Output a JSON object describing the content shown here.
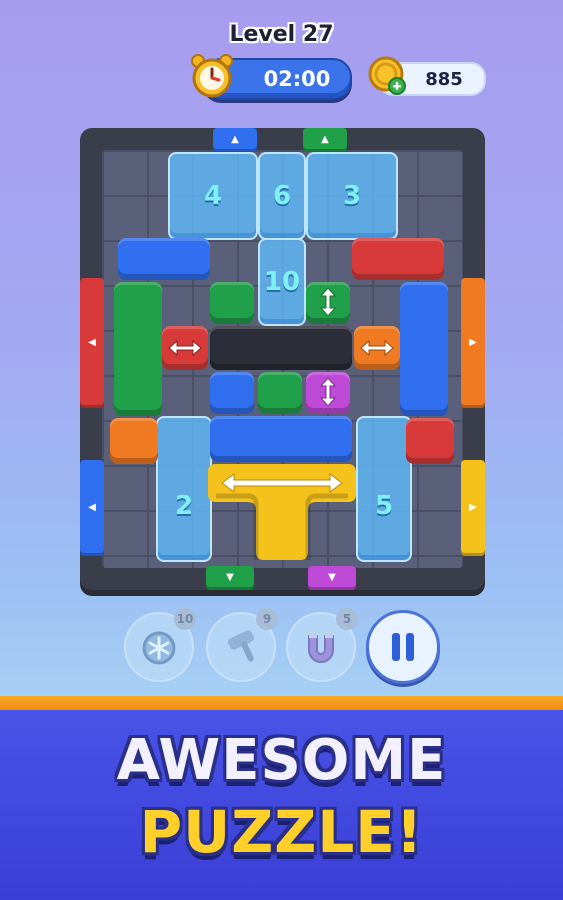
{
  "header": {
    "level_label": "Level 27",
    "timer": "02:00",
    "coins": "885",
    "clock_icon": "alarm-clock-icon",
    "coin_icon": "coin-plus-icon"
  },
  "board": {
    "ice_blocks": [
      {
        "label": "4"
      },
      {
        "label": "6"
      },
      {
        "label": "3"
      },
      {
        "label": "10"
      },
      {
        "label": "2"
      },
      {
        "label": "5"
      }
    ],
    "colors": {
      "blue": "#2f6ff0",
      "red": "#d83a3a",
      "green": "#21a04a",
      "orange": "#f07a22",
      "purple": "#c04ad8",
      "yellow": "#f5c21c",
      "dark": "#2b2e38"
    }
  },
  "boosters": [
    {
      "name": "freeze-time",
      "icon": "snowflake-clock-icon",
      "count": "10"
    },
    {
      "name": "hammer",
      "icon": "hammer-icon",
      "count": "9"
    },
    {
      "name": "magnet",
      "icon": "magnet-icon",
      "count": "5"
    }
  ],
  "pause_icon": "pause-icon",
  "banner": {
    "line1": "AWESOME",
    "line2": "PUZZLE!"
  }
}
